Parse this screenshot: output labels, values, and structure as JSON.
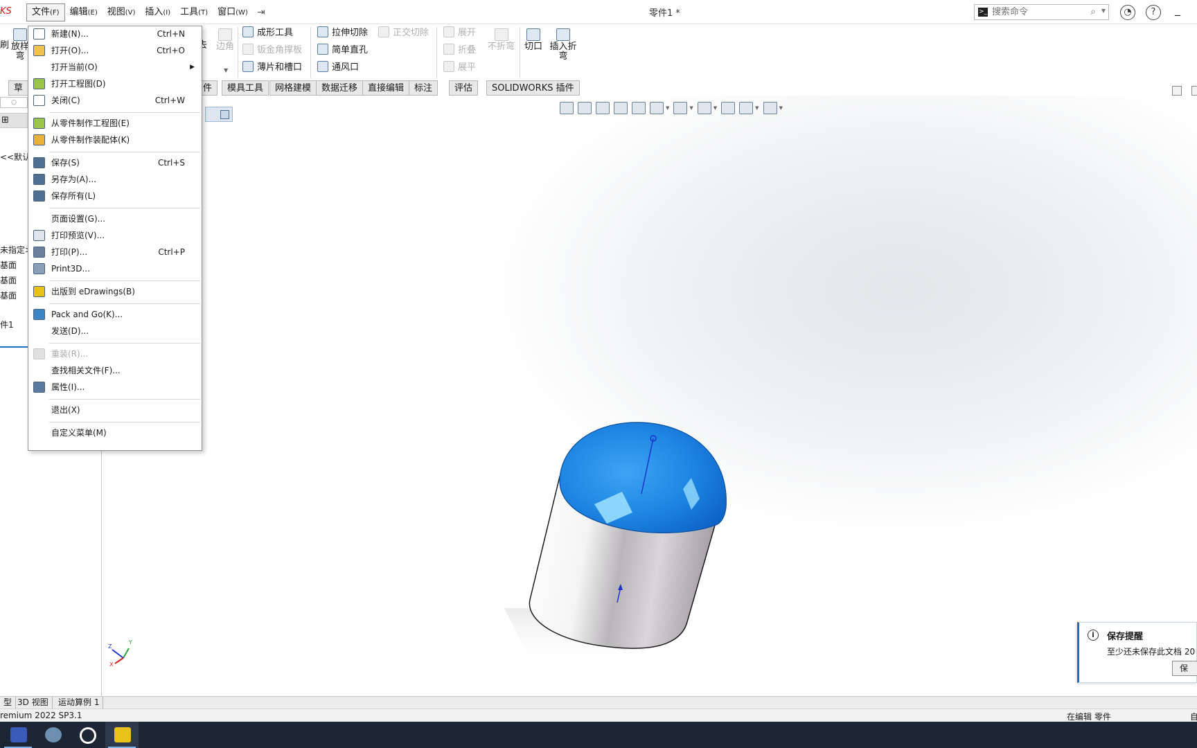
{
  "app": {
    "brand_fragment": "KS",
    "document_title": "零件1 *"
  },
  "menubar": [
    {
      "label": "文件",
      "key": "(F)",
      "active": true
    },
    {
      "label": "编辑",
      "key": "(E)"
    },
    {
      "label": "视图",
      "key": "(V)"
    },
    {
      "label": "插入",
      "key": "(I)"
    },
    {
      "label": "工具",
      "key": "(T)"
    },
    {
      "label": "窗口",
      "key": "(W)"
    }
  ],
  "search": {
    "placeholder": "搜索命令"
  },
  "ribbon": {
    "left_fragments": [
      "刷",
      "放样",
      "弯",
      "去",
      "边角"
    ],
    "buttons": {
      "forming_tool": "成形工具",
      "sheet_gusset": "钣金角撑板",
      "tab_and_slot": "薄片和槽口",
      "extruded_cut": "拉伸切除",
      "simple_hole": "简单直孔",
      "vent": "通风口",
      "normal_cut": "正交切除",
      "unfold": "展开",
      "fold": "折叠",
      "no_bends": "不折弯",
      "flatten": "展平",
      "rip": "切口",
      "insert_bends": "插入折弯"
    }
  },
  "tabs": [
    "草",
    "件",
    "模具工具",
    "网格建模",
    "数据迁移",
    "直接编辑",
    "标注",
    "评估",
    "SOLIDWORKS 插件"
  ],
  "left_panel": {
    "fragments": [
      "<<默认",
      "未指定>",
      "基面",
      "基面",
      "基面",
      "件1"
    ]
  },
  "file_menu": [
    {
      "label": "新建(N)...",
      "shortcut": "Ctrl+N",
      "icon": "new-doc-icon"
    },
    {
      "label": "打开(O)...",
      "shortcut": "Ctrl+O",
      "icon": "open-icon"
    },
    {
      "label": "打开当前(O)",
      "submenu": true
    },
    {
      "label": "打开工程图(D)",
      "icon": "drawing-icon"
    },
    {
      "label": "关闭(C)",
      "shortcut": "Ctrl+W",
      "icon": "close-doc-icon"
    },
    {
      "separator": true
    },
    {
      "label": "从零件制作工程图(E)",
      "icon": "make-drawing-icon"
    },
    {
      "label": "从零件制作装配体(K)",
      "icon": "make-assembly-icon"
    },
    {
      "separator": true
    },
    {
      "label": "保存(S)",
      "shortcut": "Ctrl+S",
      "icon": "save-icon"
    },
    {
      "label": "另存为(A)...",
      "icon": "save-as-icon"
    },
    {
      "label": "保存所有(L)",
      "icon": "save-all-icon"
    },
    {
      "separator": true
    },
    {
      "label": "页面设置(G)..."
    },
    {
      "label": "打印预览(V)...",
      "icon": "print-preview-icon"
    },
    {
      "label": "打印(P)...",
      "shortcut": "Ctrl+P",
      "icon": "print-icon"
    },
    {
      "label": "Print3D...",
      "icon": "print3d-icon"
    },
    {
      "separator": true
    },
    {
      "label": "出版到 eDrawings(B)",
      "icon": "edrawings-icon"
    },
    {
      "separator": true
    },
    {
      "label": "Pack and Go(K)...",
      "icon": "pack-and-go-icon"
    },
    {
      "label": "发送(D)..."
    },
    {
      "separator": true
    },
    {
      "label": "重装(R)...",
      "disabled": true,
      "icon": "reload-icon"
    },
    {
      "label": "查找相关文件(F)..."
    },
    {
      "label": "属性(I)...",
      "icon": "properties-icon"
    },
    {
      "separator": true
    },
    {
      "label": "退出(X)"
    },
    {
      "separator": true
    },
    {
      "label": "自定义菜单(M)"
    }
  ],
  "reminder": {
    "title": "保存提醒",
    "body": "至少还未保存此文档 20",
    "button": "保"
  },
  "model_tabs": [
    "型",
    "3D 视图",
    "运动算例 1"
  ],
  "status": {
    "version": "remium 2022 SP3.1",
    "mode": "在编辑 零件",
    "right_fragment": "自"
  },
  "triad": {
    "x": "X",
    "y": "Y",
    "z": "Z"
  },
  "colors": {
    "accent": "#1a6fbf",
    "dome_blue": "#2288e6",
    "taskbar": "#1d2634"
  }
}
